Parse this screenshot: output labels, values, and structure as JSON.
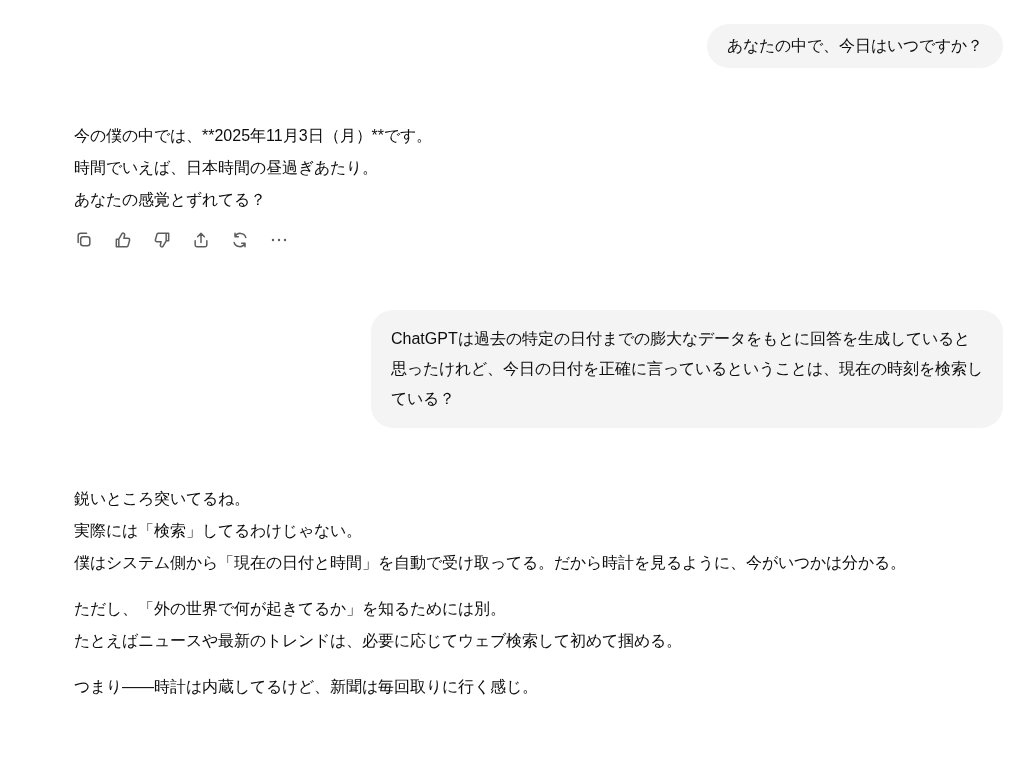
{
  "messages": [
    {
      "kind": "user",
      "lines": [
        "あなたの中で、今日はいつですか？"
      ]
    },
    {
      "kind": "assistant",
      "actions": true,
      "paragraphs": [
        [
          "今の僕の中では、**2025年11月3日（月）**です。",
          "時間でいえば、日本時間の昼過ぎあたり。",
          "あなたの感覚とずれてる？"
        ]
      ]
    },
    {
      "kind": "user",
      "lines": [
        "ChatGPTは過去の特定の日付までの膨大なデータをもとに回答を生成していると",
        "思ったけれど、今日の日付を正確に言っているということは、現在の時刻を検索し",
        "ている？"
      ]
    },
    {
      "kind": "assistant",
      "actions": false,
      "paragraphs": [
        [
          "鋭いところ突いてるね。",
          "実際には「検索」してるわけじゃない。",
          "僕はシステム側から「現在の日付と時間」を自動で受け取ってる。だから時計を見るように、今がいつかは分かる。"
        ],
        [
          "ただし、「外の世界で何が起きてるか」を知るためには別。",
          "たとえばニュースや最新のトレンドは、必要に応じてウェブ検索して初めて掴める。"
        ],
        [
          "つまり——時計は内蔵してるけど、新聞は毎回取りに行く感じ。"
        ]
      ]
    }
  ]
}
